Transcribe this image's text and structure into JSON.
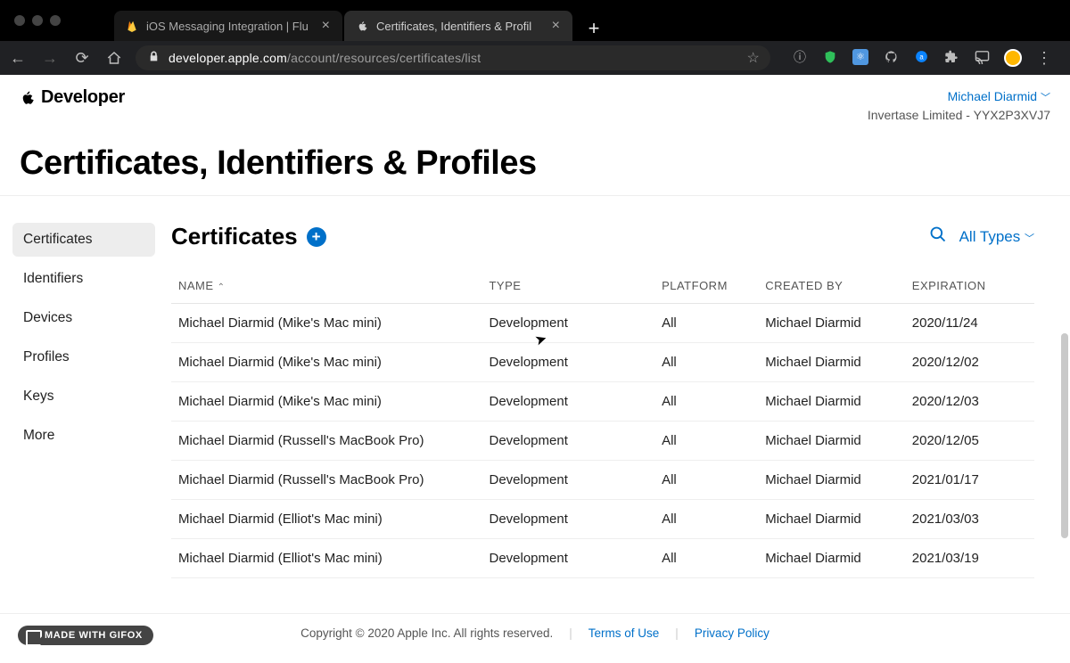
{
  "chrome": {
    "tabs": [
      {
        "title": "iOS Messaging Integration | Flu"
      },
      {
        "title": "Certificates, Identifiers & Profil"
      }
    ],
    "url_domain": "developer.apple.com",
    "url_path": "/account/resources/certificates/list"
  },
  "account": {
    "name": "Michael Diarmid",
    "team": "Invertase Limited - YYX2P3XVJ7"
  },
  "brand": "Developer",
  "page_heading": "Certificates, Identifiers & Profiles",
  "sidebar": {
    "items": [
      {
        "label": "Certificates",
        "active": true
      },
      {
        "label": "Identifiers"
      },
      {
        "label": "Devices"
      },
      {
        "label": "Profiles"
      },
      {
        "label": "Keys"
      },
      {
        "label": "More"
      }
    ]
  },
  "list": {
    "title": "Certificates",
    "filter_label": "All Types",
    "columns": {
      "name": "NAME",
      "type": "TYPE",
      "platform": "PLATFORM",
      "created_by": "CREATED BY",
      "expiration": "EXPIRATION"
    },
    "rows": [
      {
        "name": "Michael Diarmid (Mike's Mac mini)",
        "type": "Development",
        "platform": "All",
        "by": "Michael Diarmid",
        "exp": "2020/11/24"
      },
      {
        "name": "Michael Diarmid (Mike's Mac mini)",
        "type": "Development",
        "platform": "All",
        "by": "Michael Diarmid",
        "exp": "2020/12/02"
      },
      {
        "name": "Michael Diarmid (Mike's Mac mini)",
        "type": "Development",
        "platform": "All",
        "by": "Michael Diarmid",
        "exp": "2020/12/03"
      },
      {
        "name": "Michael Diarmid (Russell's MacBook Pro)",
        "type": "Development",
        "platform": "All",
        "by": "Michael Diarmid",
        "exp": "2020/12/05"
      },
      {
        "name": "Michael Diarmid (Russell's MacBook Pro)",
        "type": "Development",
        "platform": "All",
        "by": "Michael Diarmid",
        "exp": "2021/01/17"
      },
      {
        "name": "Michael Diarmid (Elliot's Mac mini)",
        "type": "Development",
        "platform": "All",
        "by": "Michael Diarmid",
        "exp": "2021/03/03"
      },
      {
        "name": "Michael Diarmid (Elliot's Mac mini)",
        "type": "Development",
        "platform": "All",
        "by": "Michael Diarmid",
        "exp": "2021/03/19"
      }
    ]
  },
  "footer": {
    "copyright": "Copyright © 2020 Apple Inc. All rights reserved.",
    "terms": "Terms of Use",
    "privacy": "Privacy Policy"
  },
  "badge": "MADE WITH GIFOX"
}
